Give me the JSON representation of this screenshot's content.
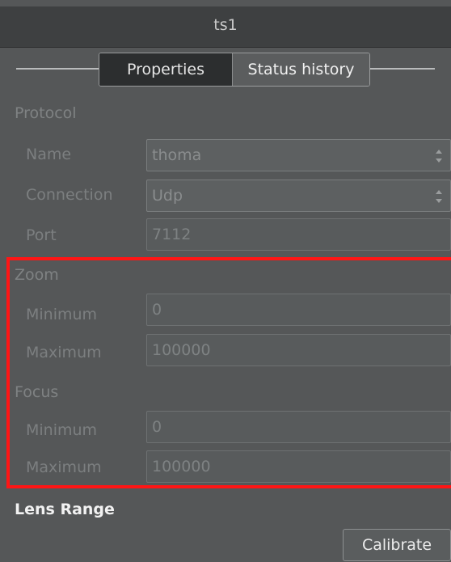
{
  "window": {
    "title": "ts1"
  },
  "tabs": [
    {
      "label": "Properties",
      "active": true
    },
    {
      "label": "Status history",
      "active": false
    }
  ],
  "protocol": {
    "header": "Protocol",
    "name": {
      "label": "Name",
      "value": "thoma"
    },
    "connection": {
      "label": "Connection",
      "value": "Udp"
    },
    "port": {
      "label": "Port",
      "value": "7112"
    }
  },
  "zoom": {
    "header": "Zoom",
    "minimum": {
      "label": "Minimum",
      "value": "0"
    },
    "maximum": {
      "label": "Maximum",
      "value": "100000"
    }
  },
  "focus": {
    "header": "Focus",
    "minimum": {
      "label": "Minimum",
      "value": "0"
    },
    "maximum": {
      "label": "Maximum",
      "value": "100000"
    }
  },
  "lens_range": {
    "header": "Lens Range",
    "calibrate_label": "Calibrate"
  },
  "colors": {
    "highlight": "#ff1515",
    "panel_bg": "#555758",
    "titlebar_bg": "#3e4041"
  }
}
